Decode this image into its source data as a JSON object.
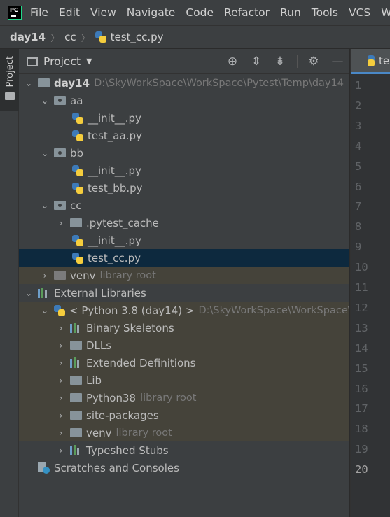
{
  "menu": {
    "logo_text": "PC",
    "items": [
      {
        "pre": "",
        "u": "F",
        "post": "ile"
      },
      {
        "pre": "",
        "u": "E",
        "post": "dit"
      },
      {
        "pre": "",
        "u": "V",
        "post": "iew"
      },
      {
        "pre": "",
        "u": "N",
        "post": "avigate"
      },
      {
        "pre": "",
        "u": "C",
        "post": "ode"
      },
      {
        "pre": "",
        "u": "R",
        "post": "efactor"
      },
      {
        "pre": "R",
        "u": "u",
        "post": "n"
      },
      {
        "pre": "",
        "u": "T",
        "post": "ools"
      },
      {
        "pre": "VC",
        "u": "S",
        "post": ""
      },
      {
        "pre": "",
        "u": "W",
        "post": "i"
      }
    ]
  },
  "breadcrumb": {
    "items": [
      "day14",
      "cc",
      "test_cc.py"
    ]
  },
  "side_stripe": {
    "label": "Project"
  },
  "panel": {
    "title": "Project",
    "tree": [
      {
        "text": "day14",
        "hint": "D:\\SkyWorkSpace\\WorkSpace\\Pytest\\Temp\\day14"
      },
      {
        "text": "aa"
      },
      {
        "text": "__init__.py"
      },
      {
        "text": "test_aa.py"
      },
      {
        "text": "bb"
      },
      {
        "text": "__init__.py"
      },
      {
        "text": "test_bb.py"
      },
      {
        "text": "cc"
      },
      {
        "text": ".pytest_cache"
      },
      {
        "text": "__init__.py"
      },
      {
        "text": "test_cc.py"
      },
      {
        "text": "venv",
        "hint": "library root"
      },
      {
        "text": "External Libraries"
      },
      {
        "text": "< Python 3.8 (day14) >",
        "hint": "D:\\SkyWorkSpace\\WorkSpace\\Pytest\\Temp"
      },
      {
        "text": "Binary Skeletons"
      },
      {
        "text": "DLLs"
      },
      {
        "text": "Extended Definitions"
      },
      {
        "text": "Lib"
      },
      {
        "text": "Python38",
        "hint": "library root"
      },
      {
        "text": "site-packages"
      },
      {
        "text": "venv",
        "hint": "library root"
      },
      {
        "text": "Typeshed Stubs"
      },
      {
        "text": "Scratches and Consoles"
      }
    ]
  },
  "editor": {
    "tab_label": "tes",
    "line_numbers": [
      "1",
      "2",
      "3",
      "4",
      "5",
      "6",
      "7",
      "8",
      "9",
      "10",
      "11",
      "12",
      "13",
      "14",
      "15",
      "16",
      "17",
      "18",
      "19",
      "20"
    ],
    "current_line": "20"
  },
  "colors": {
    "selection": "#0d293e",
    "library_row": "#45433a",
    "tab_underline": "#4a88c7"
  }
}
